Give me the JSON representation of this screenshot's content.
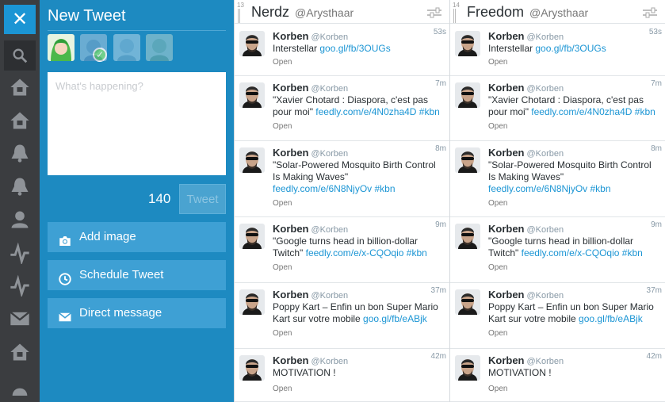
{
  "nav": {
    "close": "✕",
    "icons": [
      "search-icon",
      "home-icon",
      "home-icon",
      "bell-icon",
      "bell-icon",
      "user-icon",
      "activity-icon",
      "activity-icon",
      "mail-icon",
      "home-icon",
      "more-icon"
    ]
  },
  "compose": {
    "title": "New Tweet",
    "placeholder": "What's happening?",
    "counter": "140",
    "tweet_label": "Tweet",
    "add_image": "Add image",
    "schedule": "Schedule Tweet",
    "direct_message": "Direct message"
  },
  "columns": [
    {
      "number": "13",
      "name": "Nerdz",
      "user": "@Arysthaar",
      "tweets": [
        {
          "name": "Korben",
          "handle": "@Korben",
          "time": "53s",
          "text": "Interstellar ",
          "link": "goo.gl/fb/3OUGs",
          "tag": "",
          "open": "Open"
        },
        {
          "name": "Korben",
          "handle": "@Korben",
          "time": "7m",
          "text": "\"Xavier Chotard : Diaspora, c'est pas pour moi\" ",
          "link": "feedly.com/e/4N0zha4D",
          "tag": " #kbn",
          "open": "Open"
        },
        {
          "name": "Korben",
          "handle": "@Korben",
          "time": "8m",
          "text": "\"Solar-Powered Mosquito Birth Control Is Making Waves\" ",
          "link": "feedly.com/e/6N8NjyOv",
          "tag": " #kbn",
          "open": "Open"
        },
        {
          "name": "Korben",
          "handle": "@Korben",
          "time": "9m",
          "text": "\"Google turns head in billion-dollar Twitch\" ",
          "link": "feedly.com/e/x-CQOqio",
          "tag": " #kbn",
          "open": "Open"
        },
        {
          "name": "Korben",
          "handle": "@Korben",
          "time": "37m",
          "text": "Poppy Kart – Enfin un bon Super Mario Kart sur votre mobile ",
          "link": "goo.gl/fb/eABjk",
          "tag": "",
          "open": "Open"
        },
        {
          "name": "Korben",
          "handle": "@Korben",
          "time": "42m",
          "text": "MOTIVATION !",
          "link": "",
          "tag": "",
          "open": "Open"
        }
      ]
    },
    {
      "number": "14",
      "name": "Freedom",
      "user": "@Arysthaar",
      "tweets": [
        {
          "name": "Korben",
          "handle": "@Korben",
          "time": "53s",
          "text": "Interstellar ",
          "link": "goo.gl/fb/3OUGs",
          "tag": "",
          "open": "Open"
        },
        {
          "name": "Korben",
          "handle": "@Korben",
          "time": "7m",
          "text": "\"Xavier Chotard : Diaspora, c'est pas pour moi\" ",
          "link": "feedly.com/e/4N0zha4D",
          "tag": " #kbn",
          "open": "Open"
        },
        {
          "name": "Korben",
          "handle": "@Korben",
          "time": "8m",
          "text": "\"Solar-Powered Mosquito Birth Control Is Making Waves\" ",
          "link": "feedly.com/e/6N8NjyOv",
          "tag": " #kbn",
          "open": "Open"
        },
        {
          "name": "Korben",
          "handle": "@Korben",
          "time": "9m",
          "text": "\"Google turns head in billion-dollar Twitch\" ",
          "link": "feedly.com/e/x-CQOqio",
          "tag": " #kbn",
          "open": "Open"
        },
        {
          "name": "Korben",
          "handle": "@Korben",
          "time": "37m",
          "text": "Poppy Kart – Enfin un bon Super Mario Kart sur votre mobile ",
          "link": "goo.gl/fb/eABjk",
          "tag": "",
          "open": "Open"
        },
        {
          "name": "Korben",
          "handle": "@Korben",
          "time": "42m",
          "text": "MOTIVATION !",
          "link": "",
          "tag": "",
          "open": "Open"
        }
      ]
    }
  ]
}
